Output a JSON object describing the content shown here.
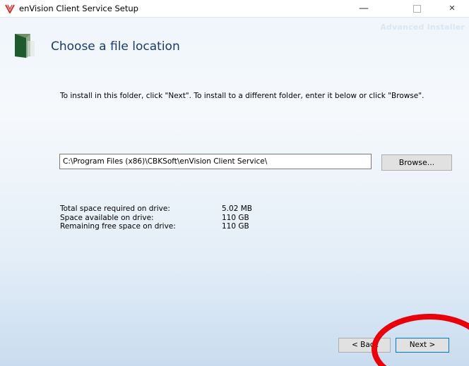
{
  "window": {
    "title": "enVision Client Service Setup",
    "brand": "Advanced Installer",
    "controls": {
      "minimize": "—",
      "close": "✕"
    }
  },
  "page": {
    "heading": "Choose a file location",
    "instructions": "To install in this folder, click \"Next\". To install to a different folder, enter it below or click \"Browse\"."
  },
  "install_path": {
    "value": "C:\\Program Files (x86)\\CBKSoft\\enVision Client Service\\"
  },
  "browse_label": "Browse...",
  "space": [
    {
      "label": "Total space required on drive:",
      "value": "5.02 MB"
    },
    {
      "label": "Space available on drive:",
      "value": "110 GB"
    },
    {
      "label": "Remaining free space on drive:",
      "value": "110 GB"
    }
  ],
  "nav": {
    "back_label": "< Back",
    "next_label": "Next >"
  },
  "colors": {
    "heading": "#1c3a6b",
    "annotation_circle": "#e8000b",
    "logo": "#d32f2f"
  },
  "icons": [
    "envision-logo-icon",
    "folder-icon",
    "minimize-icon",
    "maximize-icon",
    "close-icon"
  ]
}
